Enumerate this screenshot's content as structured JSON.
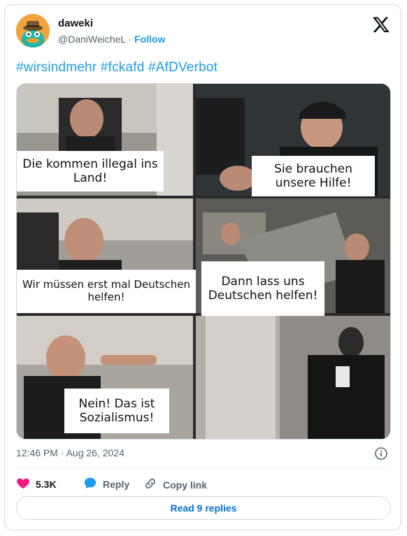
{
  "author": {
    "display_name": "daweki",
    "handle": "@DaniWeicheL",
    "separator": " · ",
    "follow_label": "Follow"
  },
  "tweet": {
    "text": "#wirsindmehr #fckafd #AfDVerbot",
    "timestamp": "12:46 PM · Aug 26, 2024"
  },
  "meme": {
    "captions": [
      "Die kommen illegal ins Land!",
      "Sie brauchen unsere Hilfe!",
      "Wir müssen erst mal Deutschen helfen!",
      "Dann lass uns Deutschen helfen!",
      "Nein! Das ist Sozialismus!"
    ]
  },
  "actions": {
    "likes_count": "5.3K",
    "reply_label": "Reply",
    "copy_link_label": "Copy link",
    "read_replies_label": "Read 9 replies"
  },
  "colors": {
    "accent": "#1d9bf0",
    "like": "#f91880",
    "text_secondary": "#536471"
  },
  "icons": [
    "avatar-platypus",
    "x-logo-icon",
    "info-icon",
    "heart-icon",
    "reply-bubble-icon",
    "link-icon"
  ]
}
